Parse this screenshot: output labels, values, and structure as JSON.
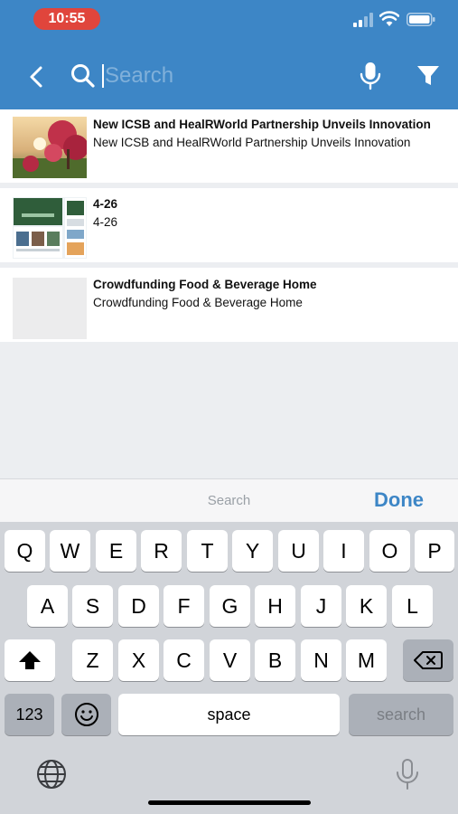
{
  "status": {
    "time": "10:55"
  },
  "header": {
    "search_placeholder": "Search"
  },
  "results": [
    {
      "title": "New ICSB and HealRWorld Partnership Unveils Innovation",
      "subtitle": "New ICSB and HealRWorld Partnership Unveils Innovation"
    },
    {
      "title": "4-26",
      "subtitle": "4-26"
    },
    {
      "title": "Crowdfunding Food & Beverage Home",
      "subtitle": "Crowdfunding Food & Beverage Home"
    }
  ],
  "keyboard": {
    "bar_label": "Search",
    "done_label": "Done",
    "row1": [
      "Q",
      "W",
      "E",
      "R",
      "T",
      "Y",
      "U",
      "I",
      "O",
      "P"
    ],
    "row2": [
      "A",
      "S",
      "D",
      "F",
      "G",
      "H",
      "J",
      "K",
      "L"
    ],
    "row3": [
      "Z",
      "X",
      "C",
      "V",
      "B",
      "N",
      "M"
    ],
    "numbers_label": "123",
    "space_label": "space",
    "search_label": "search"
  },
  "colors": {
    "header": "#3d86c6",
    "time_pill": "#e0453c",
    "done": "#3d86c6"
  },
  "icons": [
    "back-chevron-icon",
    "search-icon",
    "microphone-icon",
    "filter-icon",
    "shift-icon",
    "delete-icon",
    "emoji-icon",
    "globe-icon",
    "dictation-icon"
  ]
}
